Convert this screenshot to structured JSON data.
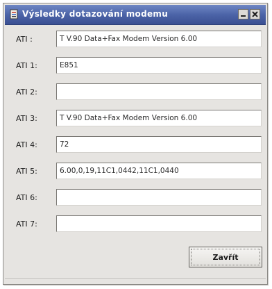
{
  "window": {
    "title": "Výsledky dotazování modemu"
  },
  "rows": [
    {
      "label": "ATI :",
      "value": "T V.90 Data+Fax Modem Version 6.00"
    },
    {
      "label": "ATI 1:",
      "value": "E851"
    },
    {
      "label": "ATI 2:",
      "value": ""
    },
    {
      "label": "ATI 3:",
      "value": "T V.90 Data+Fax Modem Version 6.00"
    },
    {
      "label": "ATI 4:",
      "value": "72"
    },
    {
      "label": "ATI 5:",
      "value": "6.00,0,19,11C1,0442,11C1,0440"
    },
    {
      "label": "ATI 6:",
      "value": ""
    },
    {
      "label": "ATI 7:",
      "value": ""
    }
  ],
  "buttons": {
    "close_label": "Zavřít"
  },
  "icons": {
    "title": "app-icon",
    "minimize": "minimize-icon",
    "close": "close-icon"
  },
  "colors": {
    "titlebar": "#4c64a8",
    "window_bg": "#e6e4e1",
    "field_bg": "#ffffff"
  }
}
